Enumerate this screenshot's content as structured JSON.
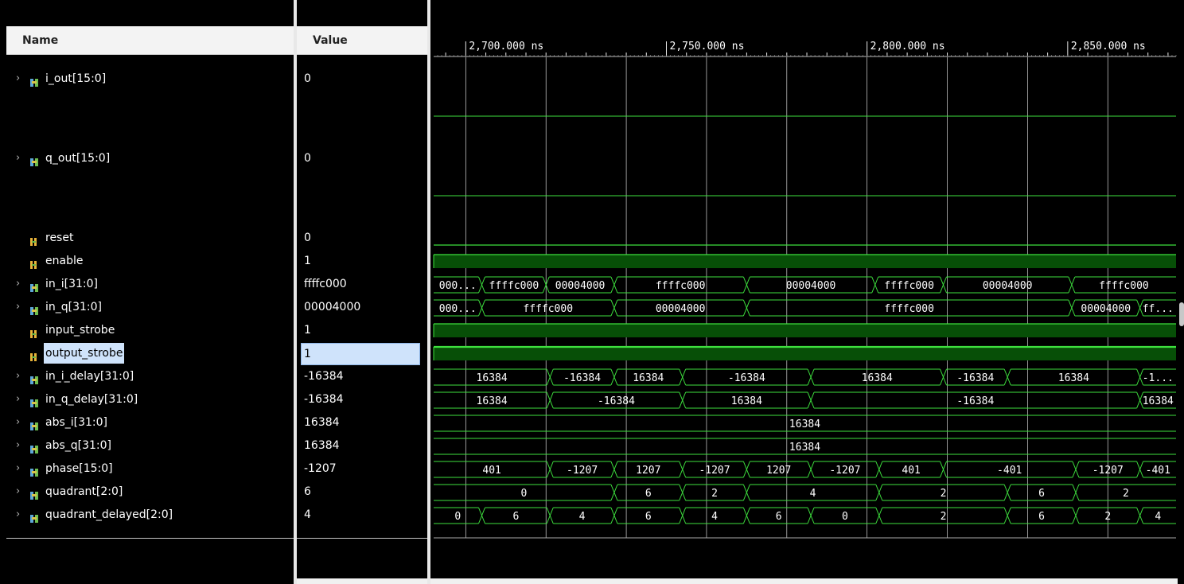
{
  "name_header": "Name",
  "value_header": "Value",
  "ruler": {
    "labels": [
      "2,700.000 ns",
      "2,750.000 ns",
      "2,800.000 ns",
      "2,850.000 ns"
    ],
    "t_start": 2692,
    "t_end": 2877
  },
  "colors": {
    "wave": "#3ee03e",
    "wave_fill": "#074f07",
    "grid": "#d8d8d8",
    "selection": "#cfe3fb",
    "header_bg": "#f3f3f3"
  },
  "signals": [
    {
      "id": "i_out",
      "name": "i_out[15:0]",
      "value": "0",
      "expandable": true,
      "icon": "bus-icon",
      "type": "analog-empty",
      "tall": true
    },
    {
      "id": "q_out",
      "name": "q_out[15:0]",
      "value": "0",
      "expandable": true,
      "icon": "bus-icon",
      "type": "analog-empty",
      "tall": true
    },
    {
      "id": "reset",
      "name": "reset",
      "value": "0",
      "expandable": false,
      "icon": "bit-icon",
      "type": "logic",
      "level": 0
    },
    {
      "id": "enable",
      "name": "enable",
      "value": "1",
      "expandable": false,
      "icon": "bit-icon",
      "type": "logic",
      "level": 1
    },
    {
      "id": "in_i",
      "name": "in_i[31:0]",
      "value": "ffffc000",
      "expandable": true,
      "icon": "bus-icon",
      "type": "bus",
      "segments": [
        {
          "t": 2692,
          "v": "000..."
        },
        {
          "t": 2704,
          "v": "ffffc000"
        },
        {
          "t": 2720,
          "v": "00004000"
        },
        {
          "t": 2737,
          "v": "ffffc000"
        },
        {
          "t": 2770,
          "v": "00004000"
        },
        {
          "t": 2802,
          "v": "ffffc000"
        },
        {
          "t": 2819,
          "v": "00004000"
        },
        {
          "t": 2851,
          "v": "ffffc000"
        }
      ]
    },
    {
      "id": "in_q",
      "name": "in_q[31:0]",
      "value": "00004000",
      "expandable": true,
      "icon": "bus-icon",
      "type": "bus",
      "segments": [
        {
          "t": 2692,
          "v": "000..."
        },
        {
          "t": 2704,
          "v": "ffffc000"
        },
        {
          "t": 2737,
          "v": "00004000"
        },
        {
          "t": 2770,
          "v": "ffffc000"
        },
        {
          "t": 2851,
          "v": "00004000"
        },
        {
          "t": 2868,
          "v": "ff..."
        }
      ]
    },
    {
      "id": "input_strobe",
      "name": "input_strobe",
      "value": "1",
      "expandable": false,
      "icon": "bit-icon",
      "type": "logic",
      "level": 1
    },
    {
      "id": "output_strobe",
      "name": "output_strobe",
      "value": "1",
      "expandable": false,
      "icon": "bit-icon",
      "type": "logic",
      "level": 1,
      "selected": true
    },
    {
      "id": "in_i_delay",
      "name": "in_i_delay[31:0]",
      "value": "-16384",
      "expandable": true,
      "icon": "bus-icon",
      "type": "bus",
      "segments": [
        {
          "t": 2692,
          "v": "16384"
        },
        {
          "t": 2721,
          "v": "-16384"
        },
        {
          "t": 2737,
          "v": "16384"
        },
        {
          "t": 2754,
          "v": "-16384"
        },
        {
          "t": 2786,
          "v": "16384"
        },
        {
          "t": 2819,
          "v": "-16384"
        },
        {
          "t": 2835,
          "v": "16384"
        },
        {
          "t": 2868,
          "v": "-1..."
        }
      ]
    },
    {
      "id": "in_q_delay",
      "name": "in_q_delay[31:0]",
      "value": "-16384",
      "expandable": true,
      "icon": "bus-icon",
      "type": "bus",
      "segments": [
        {
          "t": 2692,
          "v": "16384"
        },
        {
          "t": 2721,
          "v": "-16384"
        },
        {
          "t": 2754,
          "v": "16384"
        },
        {
          "t": 2786,
          "v": "-16384"
        },
        {
          "t": 2868,
          "v": "16384"
        }
      ]
    },
    {
      "id": "abs_i",
      "name": "abs_i[31:0]",
      "value": "16384",
      "expandable": true,
      "icon": "bus-icon",
      "type": "bus",
      "segments": [
        {
          "t": 2692,
          "v": "16384"
        }
      ]
    },
    {
      "id": "abs_q",
      "name": "abs_q[31:0]",
      "value": "16384",
      "expandable": true,
      "icon": "bus-icon",
      "type": "bus",
      "segments": [
        {
          "t": 2692,
          "v": "16384"
        }
      ]
    },
    {
      "id": "phase",
      "name": "phase[15:0]",
      "value": "-1207",
      "expandable": true,
      "icon": "bus-icon",
      "type": "bus",
      "segments": [
        {
          "t": 2692,
          "v": "401"
        },
        {
          "t": 2721,
          "v": "-1207"
        },
        {
          "t": 2737,
          "v": "1207"
        },
        {
          "t": 2754,
          "v": "-1207"
        },
        {
          "t": 2770,
          "v": "1207"
        },
        {
          "t": 2786,
          "v": "-1207"
        },
        {
          "t": 2803,
          "v": "401"
        },
        {
          "t": 2819,
          "v": "-401"
        },
        {
          "t": 2852,
          "v": "-1207"
        },
        {
          "t": 2868,
          "v": "-401"
        }
      ]
    },
    {
      "id": "quadrant",
      "name": "quadrant[2:0]",
      "value": "6",
      "expandable": true,
      "icon": "bus-icon",
      "type": "bus",
      "segments": [
        {
          "t": 2692,
          "v": "0"
        },
        {
          "t": 2737,
          "v": "6"
        },
        {
          "t": 2754,
          "v": "2"
        },
        {
          "t": 2770,
          "v": "4"
        },
        {
          "t": 2803,
          "v": "2"
        },
        {
          "t": 2835,
          "v": "6"
        },
        {
          "t": 2852,
          "v": "2"
        }
      ]
    },
    {
      "id": "quadrant_delayed",
      "name": "quadrant_delayed[2:0]",
      "value": "4",
      "expandable": true,
      "icon": "bus-icon",
      "type": "bus",
      "segments": [
        {
          "t": 2692,
          "v": "0"
        },
        {
          "t": 2704,
          "v": "6"
        },
        {
          "t": 2721,
          "v": "4"
        },
        {
          "t": 2737,
          "v": "6"
        },
        {
          "t": 2754,
          "v": "4"
        },
        {
          "t": 2770,
          "v": "6"
        },
        {
          "t": 2786,
          "v": "0"
        },
        {
          "t": 2803,
          "v": "2"
        },
        {
          "t": 2835,
          "v": "6"
        },
        {
          "t": 2852,
          "v": "2"
        },
        {
          "t": 2868,
          "v": "4"
        }
      ]
    }
  ]
}
